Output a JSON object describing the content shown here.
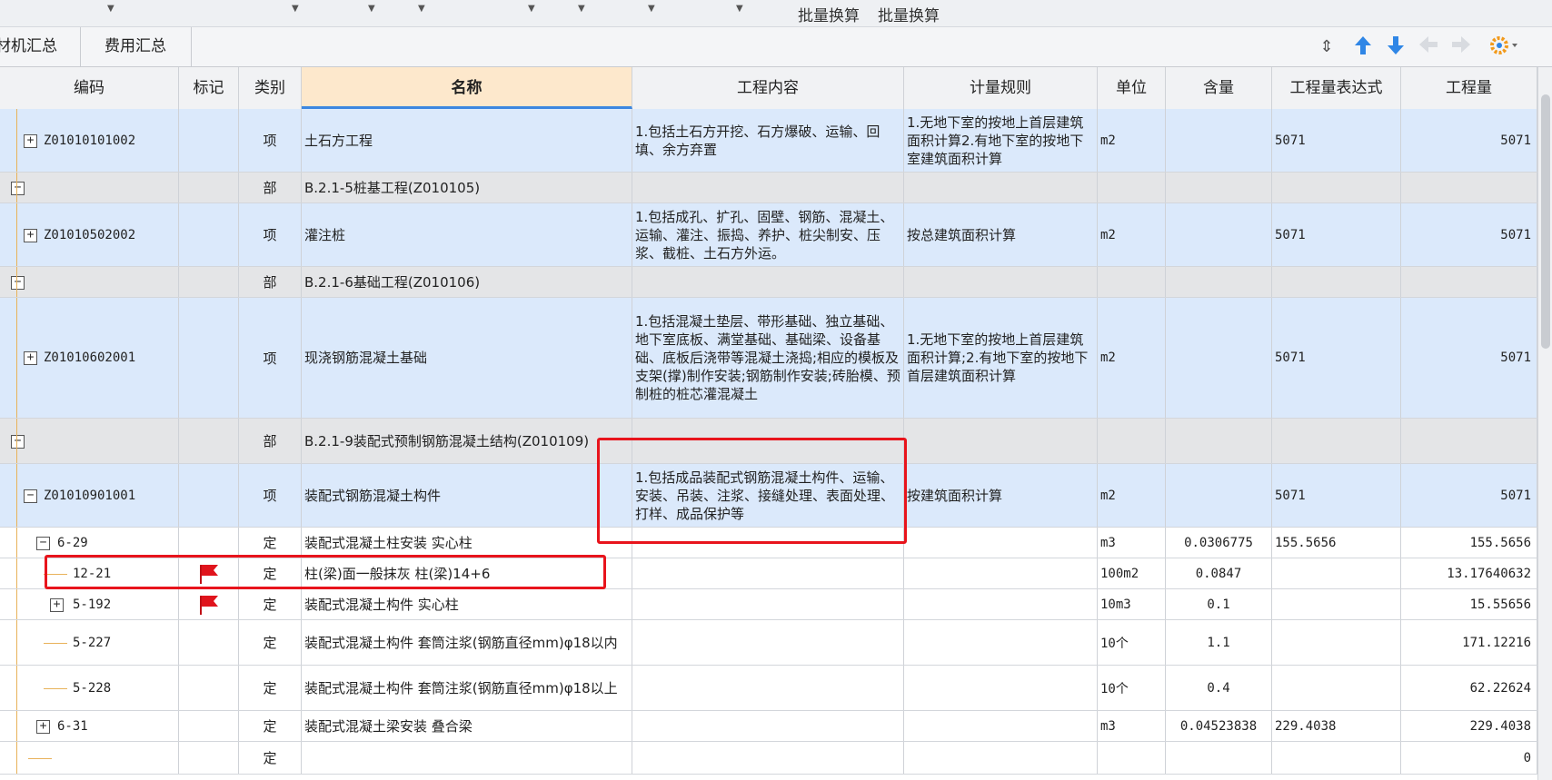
{
  "topbar": {
    "batch_convert_1": "批量换算",
    "batch_convert_2": "批量换算"
  },
  "tabs": [
    {
      "label": "材机汇总"
    },
    {
      "label": "费用汇总"
    }
  ],
  "toolbar_icons": [
    "collapse-icon",
    "arrow-up-icon",
    "arrow-down-icon",
    "arrow-left-icon",
    "arrow-right-icon",
    "settings-gear-icon"
  ],
  "colors": {
    "accent": "#3c87e0",
    "highlight_box": "#e8141c",
    "flag": "#e0141c",
    "item_row_bg": "#dbe9fb"
  },
  "columns": [
    "编码",
    "标记",
    "类别",
    "名称",
    "工程内容",
    "计量规则",
    "单位",
    "含量",
    "工程量表达式",
    "工程量"
  ],
  "rows": [
    {
      "code": "Z01010101002",
      "mark": "",
      "cat": "项",
      "name": "土石方工程",
      "content": "1.包括土石方开挖、石方爆破、运输、回填、余方弃置",
      "rule": "1.无地下室的按地上首层建筑面积计算2.有地下室的按地下室建筑面积计算",
      "unit": "m2",
      "qty": "",
      "expr": "5071",
      "amount": "5071"
    },
    {
      "code": "",
      "mark": "",
      "cat": "部",
      "name": "B.2.1-5桩基工程(Z010105)",
      "content": "",
      "rule": "",
      "unit": "",
      "qty": "",
      "expr": "",
      "amount": ""
    },
    {
      "code": "Z01010502002",
      "mark": "",
      "cat": "项",
      "name": "灌注桩",
      "content": "1.包括成孔、扩孔、固壁、钢筋、混凝土、运输、灌注、振捣、养护、桩尖制安、压浆、截桩、土石方外运。",
      "rule": "按总建筑面积计算",
      "unit": "m2",
      "qty": "",
      "expr": "5071",
      "amount": "5071"
    },
    {
      "code": "",
      "mark": "",
      "cat": "部",
      "name": "B.2.1-6基础工程(Z010106)",
      "content": "",
      "rule": "",
      "unit": "",
      "qty": "",
      "expr": "",
      "amount": ""
    },
    {
      "code": "Z01010602001",
      "mark": "",
      "cat": "项",
      "name": "现浇钢筋混凝土基础",
      "content": "1.包括混凝土垫层、带形基础、独立基础、地下室底板、满堂基础、基础梁、设备基础、底板后浇带等混凝土浇捣;相应的模板及支架(撑)制作安装;钢筋制作安装;砖胎模、预制桩的桩芯灌混凝土",
      "rule": "1.无地下室的按地上首层建筑面积计算;2.有地下室的按地下首层建筑面积计算",
      "unit": "m2",
      "qty": "",
      "expr": "5071",
      "amount": "5071"
    },
    {
      "code": "",
      "mark": "",
      "cat": "部",
      "name": "B.2.1-9装配式预制钢筋混凝土结构(Z010109)",
      "content": "",
      "rule": "",
      "unit": "",
      "qty": "",
      "expr": "",
      "amount": ""
    },
    {
      "code": "Z01010901001",
      "mark": "",
      "cat": "项",
      "name": "装配式钢筋混凝土构件",
      "content": "1.包括成品装配式钢筋混凝土构件、运输、安装、吊装、注浆、接缝处理、表面处理、打样、成品保护等",
      "rule": "按建筑面积计算",
      "unit": "m2",
      "qty": "",
      "expr": "5071",
      "amount": "5071"
    },
    {
      "code": "6-29",
      "mark": "",
      "cat": "定",
      "name": "装配式混凝土柱安装 实心柱",
      "content": "",
      "rule": "",
      "unit": "m3",
      "qty": "0.0306775",
      "expr": "155.5656",
      "amount": "155.5656"
    },
    {
      "code": "12-21",
      "mark": "flag",
      "cat": "定",
      "name": "柱(梁)面一般抹灰 柱(梁)14+6",
      "content": "",
      "rule": "",
      "unit": "100m2",
      "qty": "0.0847",
      "expr": "",
      "amount": "13.17640632"
    },
    {
      "code": "5-192",
      "mark": "flag",
      "cat": "定",
      "name": "装配式混凝土构件 实心柱",
      "content": "",
      "rule": "",
      "unit": "10m3",
      "qty": "0.1",
      "expr": "",
      "amount": "15.55656"
    },
    {
      "code": "5-227",
      "mark": "",
      "cat": "定",
      "name": "装配式混凝土构件 套筒注浆(钢筋直径mm)φ18以内",
      "content": "",
      "rule": "",
      "unit": "10个",
      "qty": "1.1",
      "expr": "",
      "amount": "171.12216"
    },
    {
      "code": "5-228",
      "mark": "",
      "cat": "定",
      "name": "装配式混凝土构件 套筒注浆(钢筋直径mm)φ18以上",
      "content": "",
      "rule": "",
      "unit": "10个",
      "qty": "0.4",
      "expr": "",
      "amount": "62.22624"
    },
    {
      "code": "6-31",
      "mark": "",
      "cat": "定",
      "name": "装配式混凝土梁安装 叠合梁",
      "content": "",
      "rule": "",
      "unit": "m3",
      "qty": "0.04523838",
      "expr": "229.4038",
      "amount": "229.4038"
    },
    {
      "code": "",
      "mark": "",
      "cat": "定",
      "name": "",
      "content": "",
      "rule": "",
      "unit": "",
      "qty": "",
      "expr": "",
      "amount": "0"
    }
  ]
}
